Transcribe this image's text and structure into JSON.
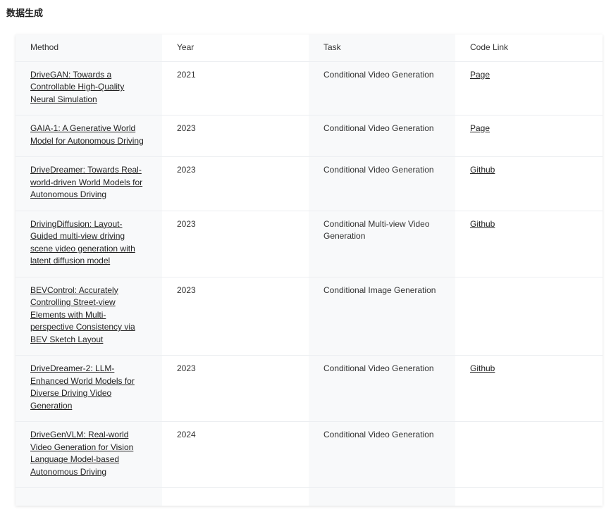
{
  "title": "数据生成",
  "columns": [
    "Method",
    "Year",
    "Task",
    "Code Link"
  ],
  "rows": [
    {
      "method": "DriveGAN: Towards a Controllable High-Quality Neural Simulation",
      "year": "2021",
      "task": "Conditional Video Generation",
      "code": "Page"
    },
    {
      "method": "GAIA-1: A Generative World Model for Autonomous Driving",
      "year": "2023",
      "task": "Conditional Video Generation",
      "code": "Page"
    },
    {
      "method": "DriveDreamer: Towards Real-world-driven World Models for Autonomous Driving",
      "year": "2023",
      "task": "Conditional Video Generation",
      "code": "Github"
    },
    {
      "method": "DrivingDiffusion: Layout-Guided multi-view driving scene video generation with latent diffusion model",
      "year": "2023",
      "task": "Conditional Multi-view Video Generation",
      "code": "Github"
    },
    {
      "method": "BEVControl: Accurately Controlling Street-view Elements with Multi-perspective Consistency via BEV Sketch Layout",
      "year": "2023",
      "task": "Conditional Image Generation",
      "code": ""
    },
    {
      "method": "DriveDreamer-2: LLM-Enhanced World Models for Diverse Driving Video Generation",
      "year": "2023",
      "task": "Conditional Video Generation",
      "code": "Github"
    },
    {
      "method": "DriveGenVLM: Real-world Video Generation for Vision Language Model-based Autonomous Driving",
      "year": "2024",
      "task": "Conditional Video Generation",
      "code": ""
    }
  ]
}
